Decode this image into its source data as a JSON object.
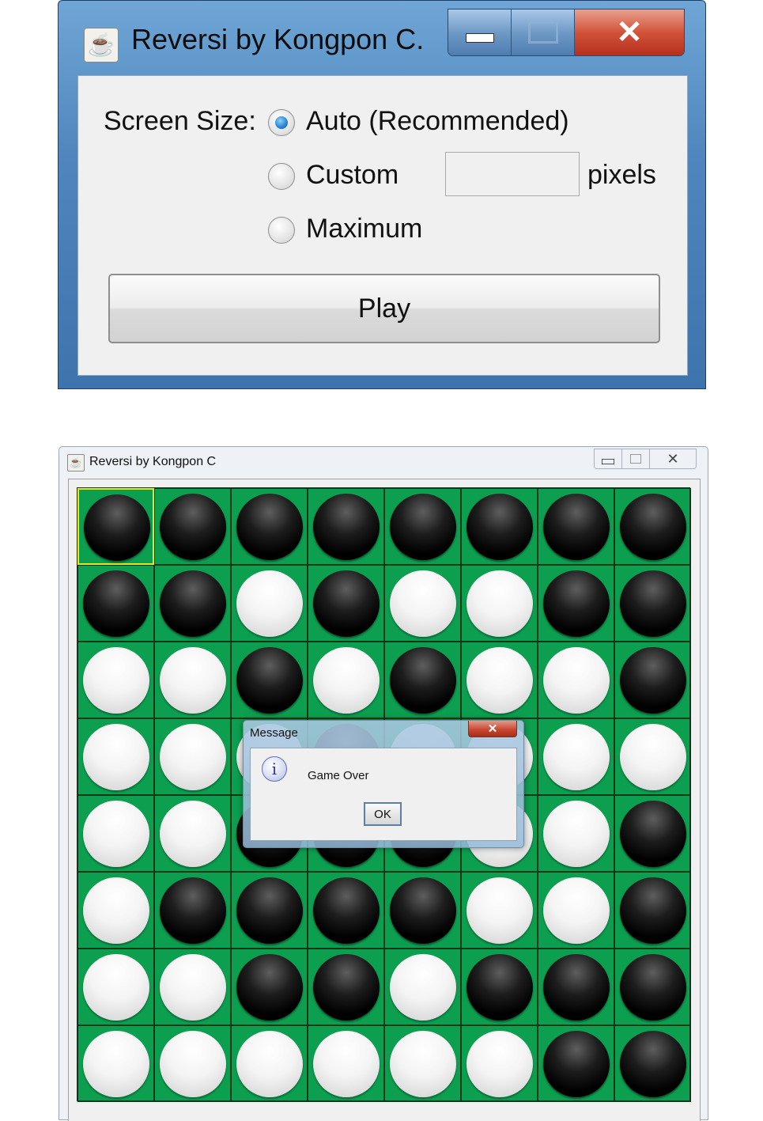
{
  "launcher": {
    "title": "Reversi by Kongpon C.",
    "screen_size_label": "Screen Size:",
    "options": [
      {
        "label": "Auto (Recommended)",
        "checked": true
      },
      {
        "label": "Custom",
        "checked": false
      },
      {
        "label": "Maximum",
        "checked": false
      }
    ],
    "custom_value": "",
    "pixels_label": "pixels",
    "play_label": "Play"
  },
  "game": {
    "title": "Reversi by Kongpon C",
    "selected_cell": [
      0,
      0
    ],
    "board": [
      "BBBBBBBB",
      "BBWBWWBB",
      "WWBWBWWB",
      "WWWBWWWW",
      "WWBBBWWB",
      "WBBBBWWB",
      "WWBBWBBB",
      "WWWWWWBB"
    ]
  },
  "dialog": {
    "title": "Message",
    "icon": "info-icon",
    "message": "Game Over",
    "ok_label": "OK"
  },
  "icons": {
    "app": "java-cup-icon",
    "minimize": "minimize-icon",
    "maximize": "maximize-icon",
    "close": "close-icon"
  }
}
